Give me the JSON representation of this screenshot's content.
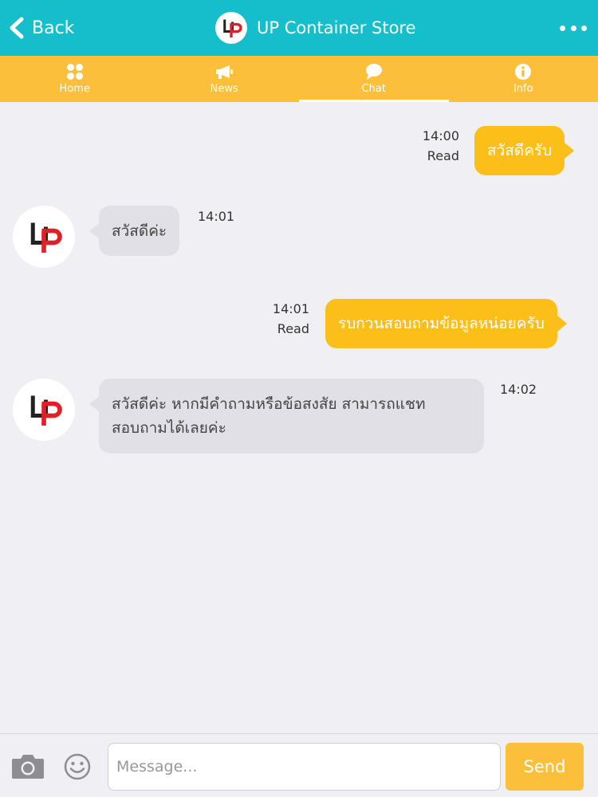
{
  "header": {
    "back_label": "Back",
    "title": "UP Container Store",
    "color": "#14bfcb"
  },
  "tabs": [
    {
      "label": "Home",
      "icon": "grid-icon"
    },
    {
      "label": "News",
      "icon": "megaphone-icon"
    },
    {
      "label": "Chat",
      "icon": "chat-bubble-icon",
      "active": true
    },
    {
      "label": "Info",
      "icon": "info-icon"
    }
  ],
  "messages": [
    {
      "direction": "out",
      "text": "สวัสดีครับ",
      "time": "14:00",
      "status": "Read"
    },
    {
      "direction": "in",
      "text": "สวัสดีค่ะ",
      "time": "14:01"
    },
    {
      "direction": "out",
      "text": "รบกวนสอบถามข้อมูลหน่อยครับ",
      "time": "14:01",
      "status": "Read"
    },
    {
      "direction": "in",
      "text_line1": "สวัสดีค่ะ หากมีคำถามหรือข้อสงสัย สามารถแชท",
      "text_line2": "สอบถามได้เลยค่ะ",
      "time": "14:02"
    }
  ],
  "input": {
    "placeholder": "Message...",
    "value": "",
    "send_label": "Send"
  },
  "colors": {
    "accent": "#fcbf3a",
    "outgoing_bubble": "#fcbf1a",
    "incoming_bubble": "#e1e0e6",
    "logo_red": "#e01f26"
  }
}
